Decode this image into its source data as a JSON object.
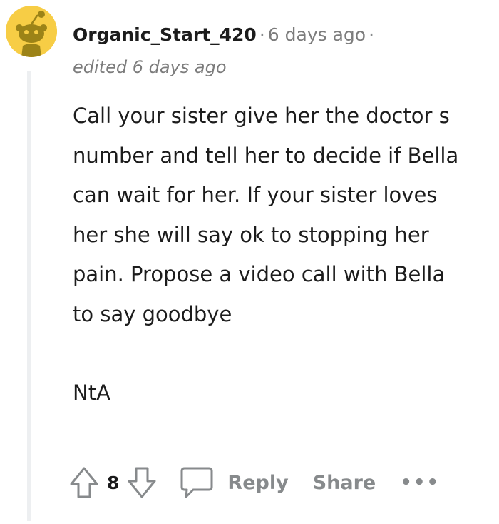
{
  "comment": {
    "username": "Organic_Start_420",
    "separator": "·",
    "timestamp": "6 days ago",
    "trailing_separator": "·",
    "edited_label": "edited 6 days ago",
    "paragraphs": [
      "Call your sister give her the doctor s number and tell her to decide if Bella can wait for her. If your sister loves her she will say ok to stopping her pain. Propose a video call with Bella to say goodbye",
      "NtA"
    ]
  },
  "actions": {
    "upvote_icon": "arrow-up-icon",
    "vote_count": "8",
    "downvote_icon": "arrow-down-icon",
    "reply_icon": "speech-bubble-icon",
    "reply_label": "Reply",
    "share_label": "Share",
    "more_label": "•••"
  },
  "colors": {
    "avatar_bg": "#f7cd45",
    "avatar_figure": "#9c8317",
    "muted_text": "#878a8c",
    "body_text": "#1c1c1c",
    "thread_line": "#edeff1"
  }
}
